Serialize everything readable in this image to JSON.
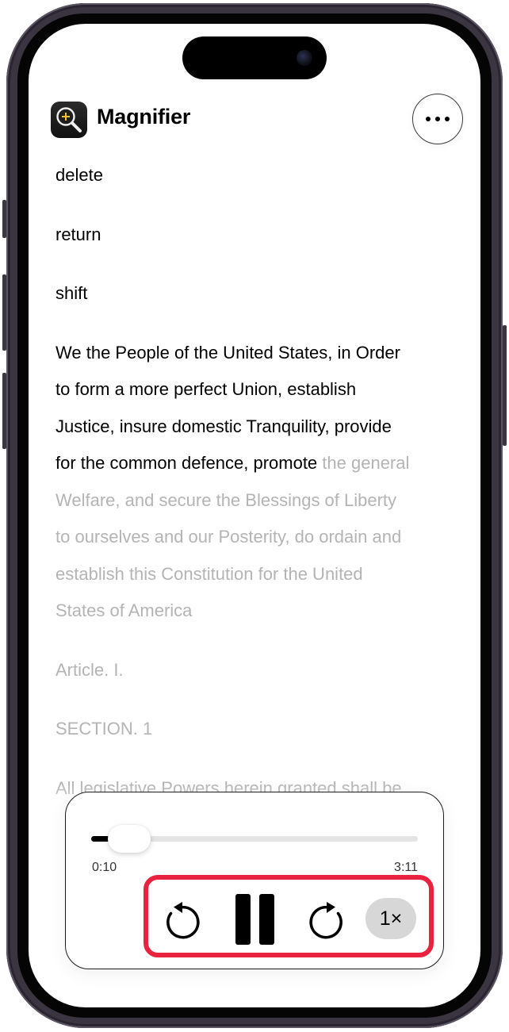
{
  "app": {
    "icon": "magnifier-app-icon",
    "title": "Magnifier",
    "more_icon": "ellipsis-icon"
  },
  "reader": {
    "short_lines": [
      "delete",
      "return",
      "shift"
    ],
    "paragraph_read": [
      "We the People of the United States, in Order",
      "to form a more perfect Union, establish",
      "Justice, insure domestic Tranquility, provide",
      "for the common defence, promote"
    ],
    "paragraph_split_unread": "the general",
    "paragraph_unread": [
      "Welfare, and secure the Blessings of Liberty",
      "to ourselves and our Posterity, do ordain and",
      "establish this Constitution for the United",
      "States of America"
    ],
    "article": "Article. I.",
    "section": "SECTION. 1",
    "partial_line": "All legislative Powers herein granted shall be"
  },
  "player": {
    "elapsed": "0:10",
    "duration": "3:11",
    "progress": 0.052,
    "skip_back_icon": "skip-back-icon",
    "pause_icon": "pause-icon",
    "skip_forward_icon": "skip-forward-icon",
    "speed_label": "1×",
    "highlight_color": "#e8223f"
  }
}
